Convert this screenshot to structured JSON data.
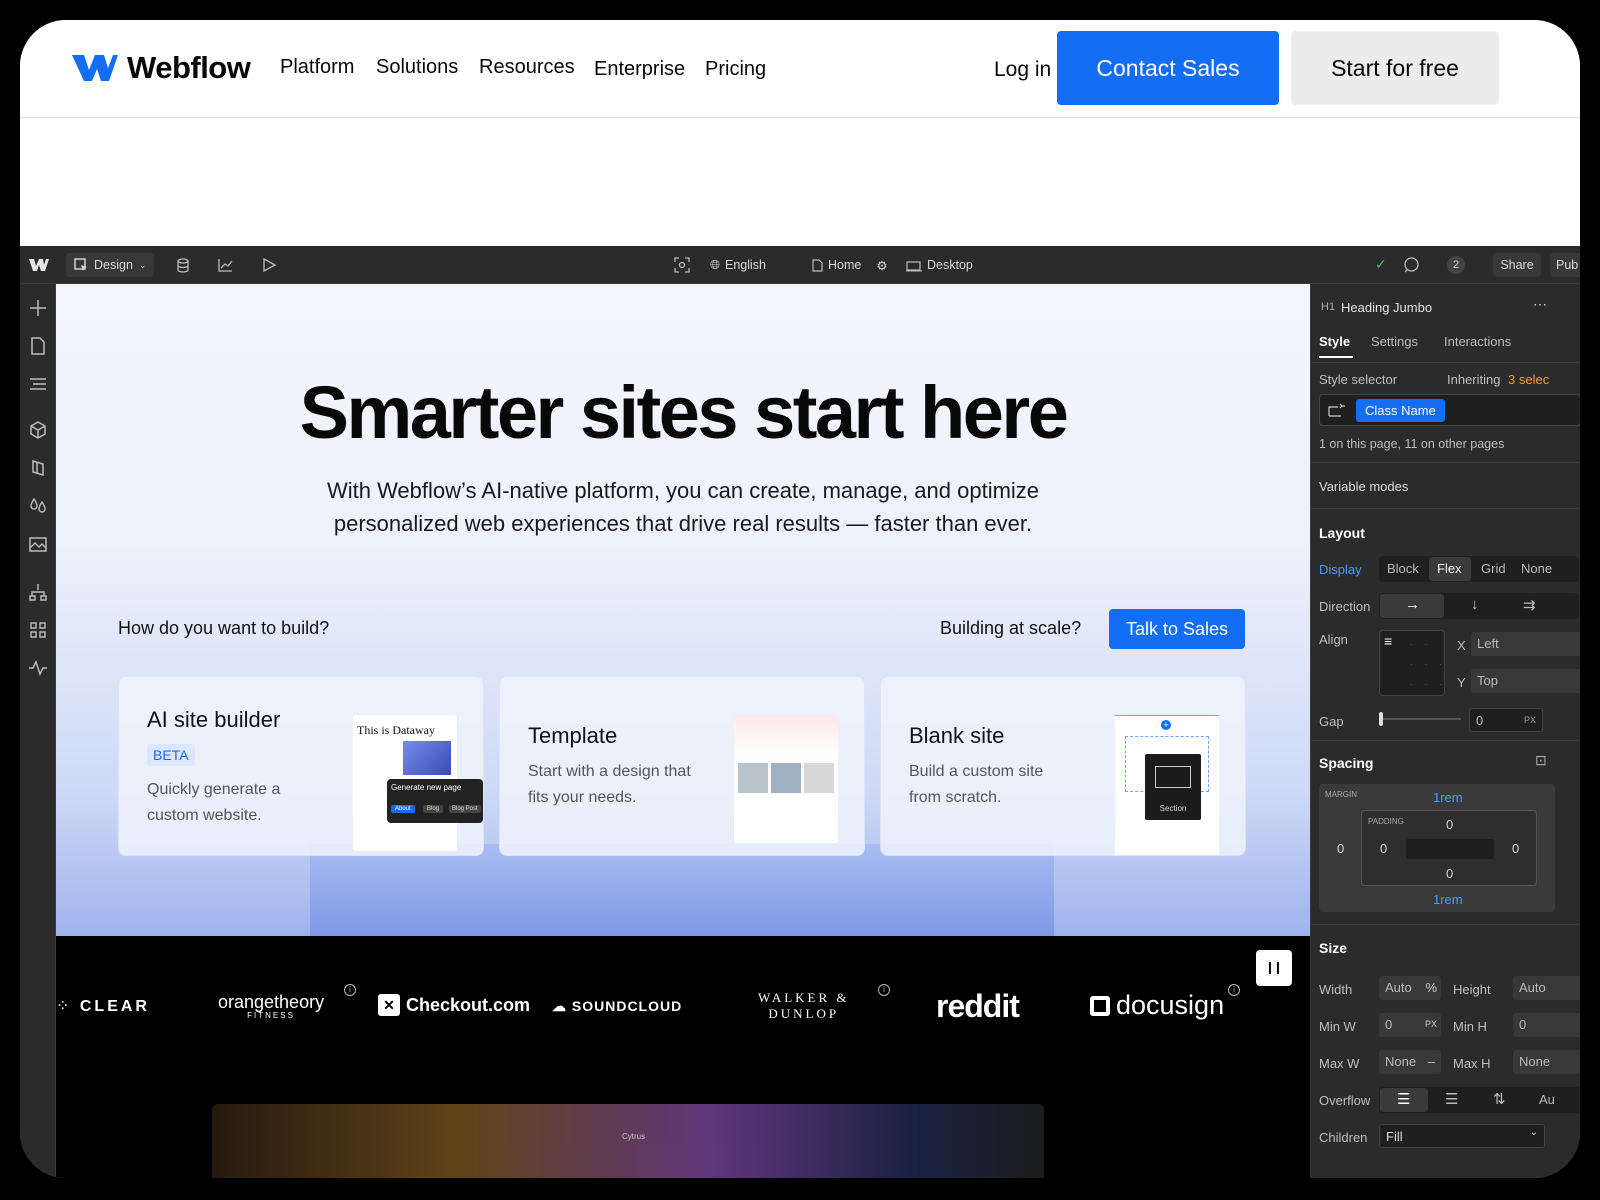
{
  "nav": {
    "brand": "Webflow",
    "links": [
      "Platform",
      "Solutions",
      "Resources",
      "Enterprise",
      "Pricing"
    ],
    "login": "Log in",
    "contact": "Contact Sales",
    "start": "Start for free",
    "accent": "#146ef5"
  },
  "designer_bar": {
    "mode": "Design",
    "language": "English",
    "page": "Home",
    "breakpoint": "Desktop",
    "comments_count": "2",
    "share": "Share",
    "publish": "Pub"
  },
  "hero": {
    "title": "Smarter sites start here",
    "subtitle": "With Webflow’s AI-native platform, you can create, manage, and optimize personalized web experiences that drive real results — faster than ever.",
    "how": "How do you want to build?",
    "scale": "Building at scale?",
    "talk": "Talk to Sales"
  },
  "cards": [
    {
      "title": "AI site builder",
      "badge": "BETA",
      "desc": "Quickly generate a custom website.",
      "thumb_title": "This is Dataway",
      "popup": "Generate new page",
      "chips": [
        "About",
        "Blog",
        "Blog Post"
      ]
    },
    {
      "title": "Template",
      "desc": "Start with a design that fits your needs."
    },
    {
      "title": "Blank site",
      "desc": "Build a custom site from scratch.",
      "thumb_label": "Section"
    }
  ],
  "logos": [
    "CLEAR",
    "orangetheory",
    "FITNESS",
    "Checkout.com",
    "SOUNDCLOUD",
    "WALKER &",
    "DUNLOP",
    "reddit",
    "docusign"
  ],
  "preview": {
    "title": "Cytrus"
  },
  "panel": {
    "element_tag": "H1",
    "element_name": "Heading Jumbo",
    "tabs": [
      "Style",
      "Settings",
      "Interactions"
    ],
    "style_selector": "Style selector",
    "inheriting": "Inheriting",
    "inheriting_count": "3 selec",
    "class_name": "Class Name",
    "usage": "1 on this page, 11 on other pages",
    "variable_modes": "Variable modes",
    "layout": "Layout",
    "display": "Display",
    "display_options": [
      "Block",
      "Flex",
      "Grid",
      "None"
    ],
    "direction": "Direction",
    "align": "Align",
    "x_label": "X",
    "x_value": "Left",
    "y_label": "Y",
    "y_value": "Top",
    "gap": "Gap",
    "gap_value": "0",
    "gap_unit": "PX",
    "spacing": "Spacing",
    "margin": "MARGIN",
    "padding": "PADDING",
    "margin_top": "1rem",
    "margin_bottom": "1rem",
    "margin_left": "0",
    "margin_right": "0",
    "padding_top": "0",
    "padding_bottom": "0",
    "padding_left": "0",
    "padding_right": "0",
    "size": "Size",
    "width": "Width",
    "width_value": "Auto",
    "width_unit": "%",
    "height": "Height",
    "height_value": "Auto",
    "min_w": "Min W",
    "min_w_value": "0",
    "min_w_unit": "PX",
    "min_h": "Min H",
    "min_h_value": "0",
    "max_w": "Max W",
    "max_w_value": "None",
    "max_w_unit": "–",
    "max_h": "Max H",
    "max_h_value": "None",
    "overflow": "Overflow",
    "overflow_last": "Au",
    "children": "Children",
    "children_value": "Fill"
  }
}
